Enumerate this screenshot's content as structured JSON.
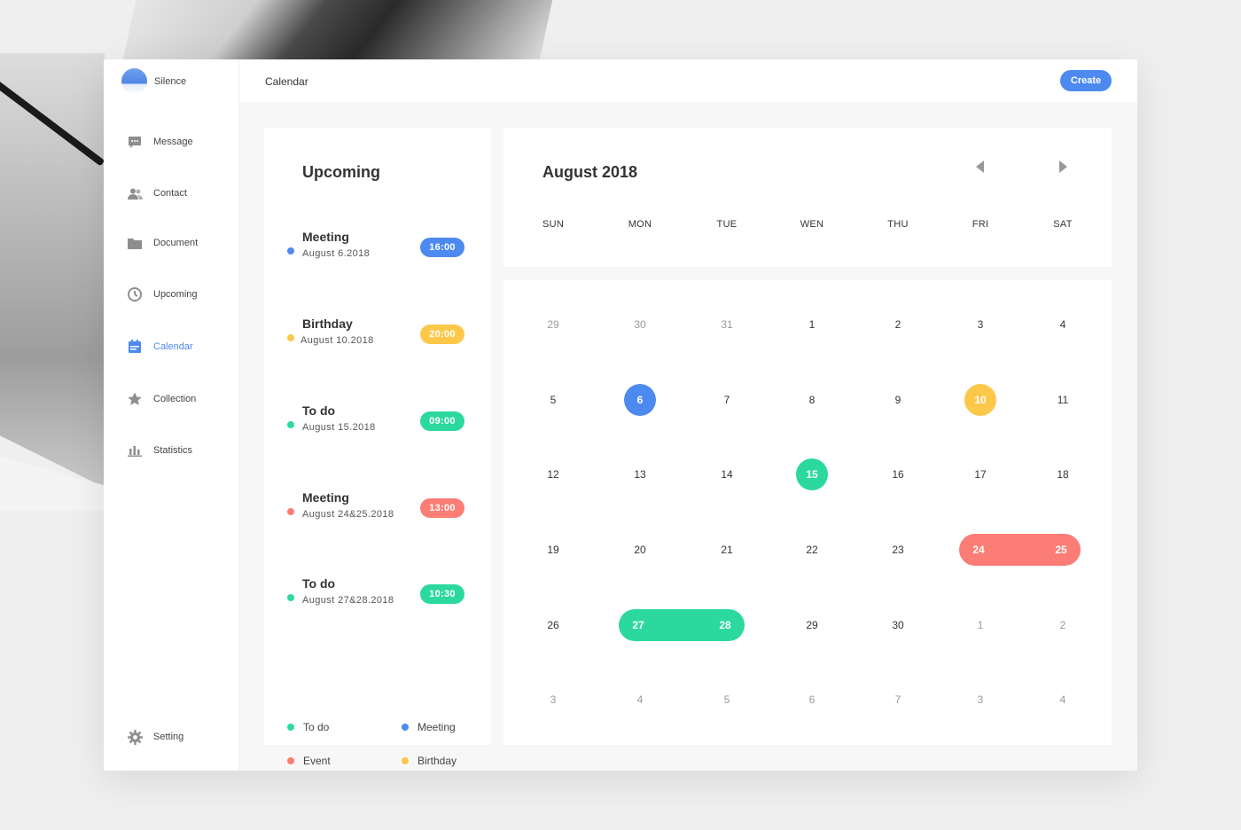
{
  "colors": {
    "blue": "#4d8af0",
    "yellow": "#fcc84a",
    "green": "#2bd99e",
    "red": "#fb7d75",
    "muted": "#999999"
  },
  "profile": {
    "name": "Silence"
  },
  "sidebar": {
    "items": [
      {
        "label": "Message",
        "icon": "message-icon"
      },
      {
        "label": "Contact",
        "icon": "contact-icon"
      },
      {
        "label": "Document",
        "icon": "folder-icon"
      },
      {
        "label": "Upcoming",
        "icon": "clock-icon"
      },
      {
        "label": "Calendar",
        "icon": "calendar-icon",
        "active": true
      },
      {
        "label": "Collection",
        "icon": "star-icon"
      },
      {
        "label": "Statistics",
        "icon": "bar-chart-icon"
      }
    ],
    "setting": {
      "label": "Setting",
      "icon": "gear-icon"
    }
  },
  "header": {
    "title": "Calendar",
    "create_label": "Create"
  },
  "upcoming": {
    "title": "Upcoming",
    "events": [
      {
        "name": "Meeting",
        "date": "August 6.2018",
        "time": "16:00",
        "color": "blue"
      },
      {
        "name": "Birthday",
        "date": "August 10.2018",
        "time": "20:00",
        "color": "yellow"
      },
      {
        "name": "To do",
        "date": "August 15.2018",
        "time": "09:00",
        "color": "green"
      },
      {
        "name": "Meeting",
        "date": "August 24&25.2018",
        "time": "13:00",
        "color": "red"
      },
      {
        "name": "To do",
        "date": "August 27&28.2018",
        "time": "10:30",
        "color": "green"
      }
    ],
    "legend": [
      {
        "label": "To do",
        "color": "green"
      },
      {
        "label": "Meeting",
        "color": "blue"
      },
      {
        "label": "Event",
        "color": "red"
      },
      {
        "label": "Birthday",
        "color": "yellow"
      }
    ]
  },
  "calendar": {
    "month_title": "August 2018",
    "weekdays": [
      "SUN",
      "MON",
      "TUE",
      "WEN",
      "THU",
      "FRI",
      "SAT"
    ],
    "weeks": [
      [
        {
          "d": "29",
          "m": true
        },
        {
          "d": "30",
          "m": true
        },
        {
          "d": "31",
          "m": true
        },
        {
          "d": "1"
        },
        {
          "d": "2"
        },
        {
          "d": "3"
        },
        {
          "d": "4"
        }
      ],
      [
        {
          "d": "5"
        },
        {
          "d": "6",
          "c": "blue"
        },
        {
          "d": "7"
        },
        {
          "d": "8"
        },
        {
          "d": "9"
        },
        {
          "d": "10",
          "c": "yellow"
        },
        {
          "d": "11"
        }
      ],
      [
        {
          "d": "12"
        },
        {
          "d": "13"
        },
        {
          "d": "14"
        },
        {
          "d": "15",
          "c": "green"
        },
        {
          "d": "16"
        },
        {
          "d": "17"
        },
        {
          "d": "18"
        }
      ],
      [
        {
          "d": "19"
        },
        {
          "d": "20"
        },
        {
          "d": "21"
        },
        {
          "d": "22"
        },
        {
          "d": "23"
        },
        {
          "d": "24",
          "r": "red"
        },
        {
          "d": "25",
          "r": "red"
        }
      ],
      [
        {
          "d": "26"
        },
        {
          "d": "27",
          "r": "green"
        },
        {
          "d": "28",
          "r": "green"
        },
        {
          "d": "29"
        },
        {
          "d": "30"
        },
        {
          "d": "1",
          "m": true
        },
        {
          "d": "2",
          "m": true
        }
      ],
      [
        {
          "d": "3",
          "m": true
        },
        {
          "d": "4",
          "m": true
        },
        {
          "d": "5",
          "m": true
        },
        {
          "d": "6",
          "m": true
        },
        {
          "d": "7",
          "m": true
        },
        {
          "d": "3",
          "m": true
        },
        {
          "d": "4",
          "m": true
        }
      ]
    ]
  }
}
